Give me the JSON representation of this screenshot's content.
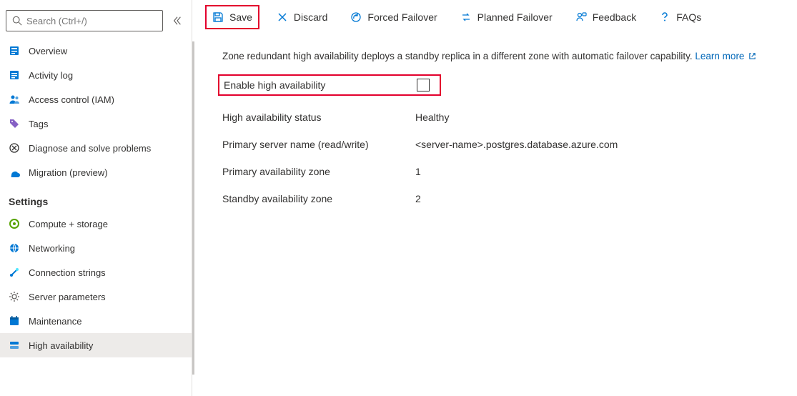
{
  "sidebar": {
    "search_placeholder": "Search (Ctrl+/)",
    "items": [
      {
        "label": "Overview",
        "icon": "overview"
      },
      {
        "label": "Activity log",
        "icon": "activitylog"
      },
      {
        "label": "Access control (IAM)",
        "icon": "iam"
      },
      {
        "label": "Tags",
        "icon": "tags"
      },
      {
        "label": "Diagnose and solve problems",
        "icon": "diagnose"
      },
      {
        "label": "Migration (preview)",
        "icon": "migration"
      }
    ],
    "section": "Settings",
    "settings_items": [
      {
        "label": "Compute + storage",
        "icon": "compute"
      },
      {
        "label": "Networking",
        "icon": "networking"
      },
      {
        "label": "Connection strings",
        "icon": "connstrings"
      },
      {
        "label": "Server parameters",
        "icon": "serverparams"
      },
      {
        "label": "Maintenance",
        "icon": "maintenance"
      },
      {
        "label": "High availability",
        "icon": "highavailability",
        "selected": true
      }
    ]
  },
  "toolbar": {
    "save": "Save",
    "discard": "Discard",
    "forced_failover": "Forced Failover",
    "planned_failover": "Planned Failover",
    "feedback": "Feedback",
    "faqs": "FAQs"
  },
  "content": {
    "description": "Zone redundant high availability deploys a standby replica in a different zone with automatic failover capability.",
    "learn_more": "Learn more",
    "enable_label": "Enable high availability",
    "enable_checked": false,
    "rows": {
      "ha_status_label": "High availability status",
      "ha_status_value": "Healthy",
      "primary_name_label": "Primary server name (read/write)",
      "primary_name_value": "<server-name>.postgres.database.azure.com",
      "primary_zone_label": "Primary availability zone",
      "primary_zone_value": "1",
      "standby_zone_label": "Standby availability zone",
      "standby_zone_value": "2"
    }
  }
}
